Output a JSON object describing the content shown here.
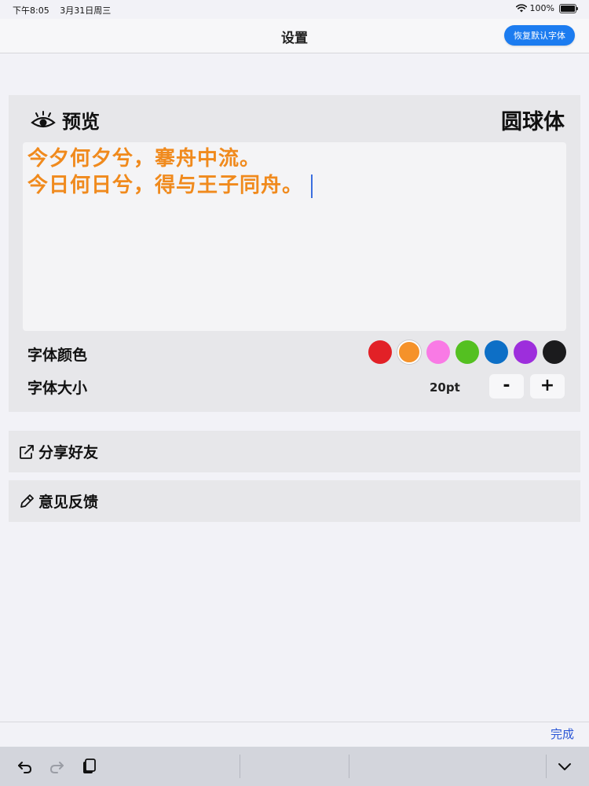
{
  "status": {
    "time": "下午8:05",
    "date": "3月31日周三",
    "battery_percent": "100%",
    "wifi_icon": "wifi-icon",
    "battery_icon": "battery-icon"
  },
  "nav": {
    "title": "设置",
    "reset_label": "恢复默认字体"
  },
  "preview": {
    "title": "预览",
    "icon": "eye-icon",
    "font_name": "圆球体",
    "lines": [
      "今夕何夕兮，搴舟中流。",
      "今日何日兮，得与王子同舟。"
    ],
    "text_color": "#f08a1d"
  },
  "font_color": {
    "label": "字体颜色",
    "selected": "#f5922a",
    "swatches": [
      "#e22127",
      "#f5922a",
      "#f97ae5",
      "#54c021",
      "#0d6fc6",
      "#9d2edc",
      "#1b1b1d"
    ]
  },
  "font_size": {
    "label": "字体大小",
    "value": "20pt",
    "minus_label": "-",
    "plus_label": "+"
  },
  "actions": {
    "share_label": "分享好友",
    "share_icon": "share-icon",
    "feedback_label": "意见反馈",
    "feedback_icon": "pencil-icon"
  },
  "keyboard": {
    "done_label": "完成",
    "undo_icon": "undo-icon",
    "redo_icon": "redo-icon",
    "paste_icon": "clipboard-icon",
    "dismiss_icon": "chevron-down-icon"
  }
}
